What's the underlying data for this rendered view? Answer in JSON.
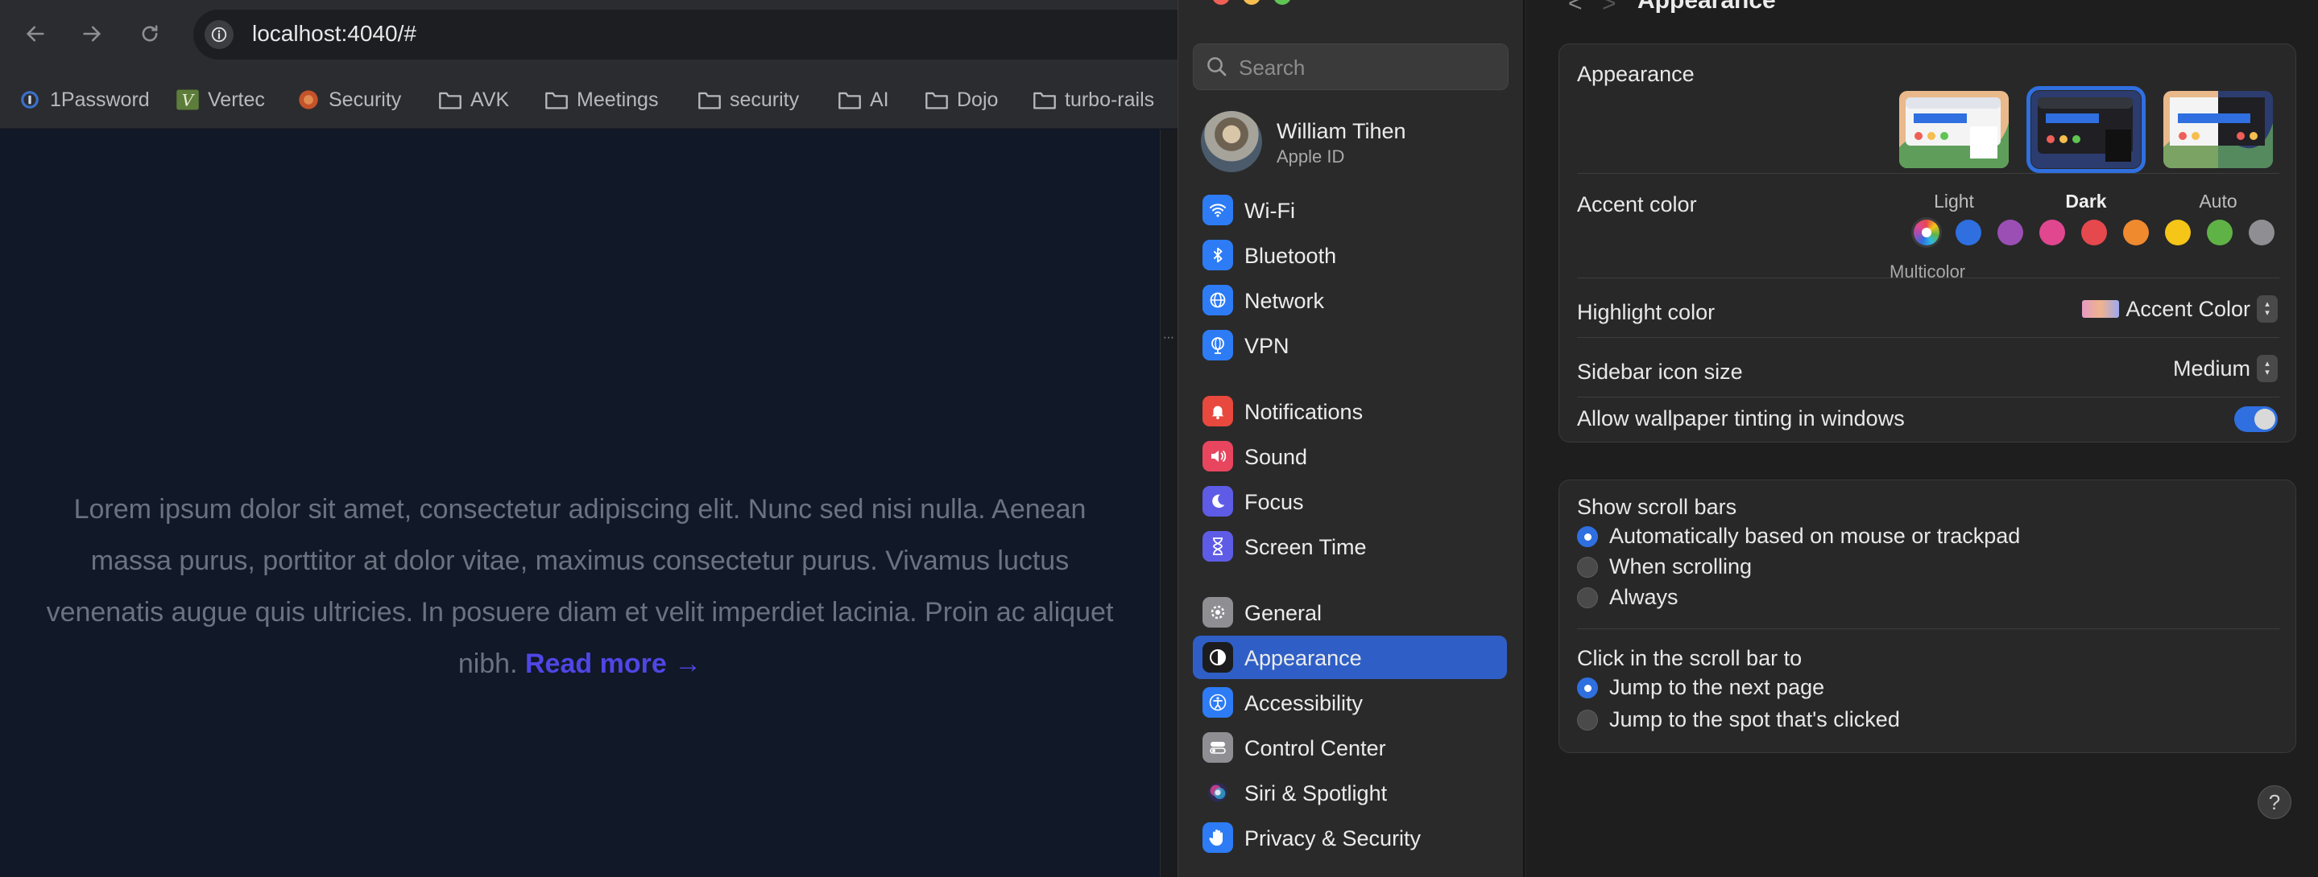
{
  "browser": {
    "url": "localhost:4040/#",
    "bookmarks": [
      {
        "label": "1Password",
        "icon": "1password-icon"
      },
      {
        "label": "Vertec",
        "icon": "vertec-icon"
      },
      {
        "label": "Security",
        "icon": "security-site-icon"
      },
      {
        "label": "AVK",
        "icon": "folder-icon"
      },
      {
        "label": "Meetings",
        "icon": "folder-icon"
      },
      {
        "label": "security",
        "icon": "folder-icon"
      },
      {
        "label": "AI",
        "icon": "folder-icon"
      },
      {
        "label": "Dojo",
        "icon": "folder-icon"
      },
      {
        "label": "turbo-rails",
        "icon": "folder-icon"
      }
    ],
    "page": {
      "body_text": "Lorem ipsum dolor sit amet, consectetur adipiscing elit. Nunc sed nisi nulla. Aenean massa purus, porttitor at dolor vitae, maximus consectetur purus. Vivamus luctus venenatis augue quis ultricies. In posuere diam et velit imperdiet lacinia. Proin ac aliquet nibh.",
      "read_more": "Read more →"
    }
  },
  "settings": {
    "search_placeholder": "Search",
    "profile": {
      "name": "William Tihen",
      "subtitle": "Apple ID"
    },
    "sidebar_items": [
      {
        "label": "Wi-Fi",
        "icon": "wifi-icon",
        "color": "#2d7cf6"
      },
      {
        "label": "Bluetooth",
        "icon": "bluetooth-icon",
        "color": "#2d7cf6"
      },
      {
        "label": "Network",
        "icon": "globe-icon",
        "color": "#2d7cf6"
      },
      {
        "label": "VPN",
        "icon": "vpn-globe-icon",
        "color": "#2d7cf6"
      },
      {
        "label": "Notifications",
        "icon": "bell-icon",
        "color": "#e8483d"
      },
      {
        "label": "Sound",
        "icon": "speaker-icon",
        "color": "#e8455f"
      },
      {
        "label": "Focus",
        "icon": "moon-icon",
        "color": "#5e5ce6"
      },
      {
        "label": "Screen Time",
        "icon": "hourglass-icon",
        "color": "#5e5ce6"
      },
      {
        "label": "General",
        "icon": "gear-icon",
        "color": "#8e8e93"
      },
      {
        "label": "Appearance",
        "icon": "appearance-icon",
        "color": "#1c1c1e"
      },
      {
        "label": "Accessibility",
        "icon": "accessibility-icon",
        "color": "#2d7cf6"
      },
      {
        "label": "Control Center",
        "icon": "control-center-icon",
        "color": "#8e8e93"
      },
      {
        "label": "Siri & Spotlight",
        "icon": "siri-icon",
        "color": "#6a4fd6"
      },
      {
        "label": "Privacy & Security",
        "icon": "hand-icon",
        "color": "#2d7cf6"
      }
    ],
    "selected_item": "Appearance",
    "page_title": "Appearance",
    "appearance": {
      "label": "Appearance",
      "options": [
        "Light",
        "Dark",
        "Auto"
      ],
      "selected": "Dark"
    },
    "accent": {
      "label": "Accent color",
      "colors": [
        "#multicolor",
        "#2f6fe0",
        "#9b4fb5",
        "#e0478f",
        "#e5484d",
        "#ef8a2f",
        "#f5c518",
        "#5fb346",
        "#8e8e93"
      ],
      "selected_label": "Multicolor"
    },
    "highlight": {
      "label": "Highlight color",
      "value": "Accent Color"
    },
    "sidebar_icon_size": {
      "label": "Sidebar icon size",
      "value": "Medium"
    },
    "wallpaper_tinting": {
      "label": "Allow wallpaper tinting in windows",
      "enabled": true
    },
    "scroll_bars": {
      "label": "Show scroll bars",
      "options": [
        "Automatically based on mouse or trackpad",
        "When scrolling",
        "Always"
      ],
      "selected": 0
    },
    "click_scroll": {
      "label": "Click in the scroll bar to",
      "options": [
        "Jump to the next page",
        "Jump to the spot that's clicked"
      ],
      "selected": 0
    },
    "help": "?"
  }
}
